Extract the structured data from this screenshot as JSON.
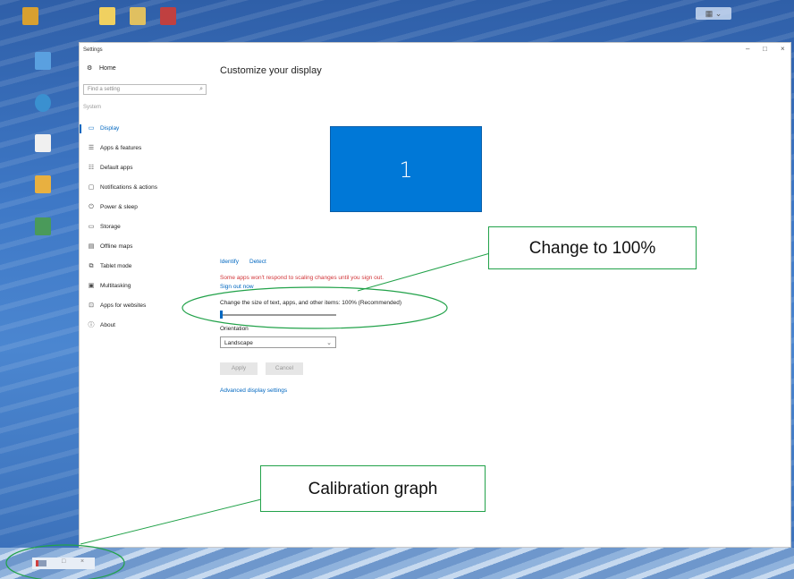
{
  "desktop": {
    "icons": [
      {
        "label": "",
        "color": "#d8a030"
      },
      {
        "label": "",
        "color": "#5aa0e0"
      },
      {
        "label": "",
        "color": "#3a90d0"
      },
      {
        "label": "",
        "color": "#f0f0f0"
      },
      {
        "label": "",
        "color": "#e8b040"
      },
      {
        "label": "",
        "color": "#4a9a5a"
      },
      {
        "label": "",
        "color": "#f0d060"
      },
      {
        "label": "",
        "color": "#e0c060"
      },
      {
        "label": "",
        "color": "#c04040"
      }
    ]
  },
  "window": {
    "title": "Settings",
    "minimize": "–",
    "maximize": "□",
    "close": "×"
  },
  "nav": {
    "home": "Home",
    "search_placeholder": "Find a setting",
    "section": "System",
    "items": [
      {
        "icon": "display-icon",
        "glyph": "▭",
        "label": "Display"
      },
      {
        "icon": "apps-icon",
        "glyph": "☰",
        "label": "Apps & features"
      },
      {
        "icon": "default-apps-icon",
        "glyph": "☷",
        "label": "Default apps"
      },
      {
        "icon": "notifications-icon",
        "glyph": "▢",
        "label": "Notifications & actions"
      },
      {
        "icon": "power-icon",
        "glyph": "⏻",
        "label": "Power & sleep"
      },
      {
        "icon": "storage-icon",
        "glyph": "▭",
        "label": "Storage"
      },
      {
        "icon": "map-icon",
        "glyph": "▤",
        "label": "Offline maps"
      },
      {
        "icon": "tablet-icon",
        "glyph": "⧉",
        "label": "Tablet mode"
      },
      {
        "icon": "multitasking-icon",
        "glyph": "▣",
        "label": "Multitasking"
      },
      {
        "icon": "web-icon",
        "glyph": "⊡",
        "label": "Apps for websites"
      },
      {
        "icon": "info-icon",
        "glyph": "ⓘ",
        "label": "About"
      }
    ]
  },
  "main": {
    "title": "Customize your display",
    "monitor_number": "1",
    "identify": "Identify",
    "detect": "Detect",
    "warning": "Some apps won't respond to scaling changes until you sign out.",
    "sign_out": "Sign out now",
    "scale_label": "Change the size of text, apps, and other items: 100% (Recommended)",
    "scale_percent": 100,
    "orientation_label": "Orientation",
    "orientation_value": "Landscape",
    "apply": "Apply",
    "cancel": "Cancel",
    "advanced": "Advanced display settings"
  },
  "annotations": {
    "change": "Change to 100%",
    "calibration": "Calibration graph",
    "color": "#22a24a"
  },
  "calibration_window": {
    "maximize": "□",
    "close": "×"
  }
}
